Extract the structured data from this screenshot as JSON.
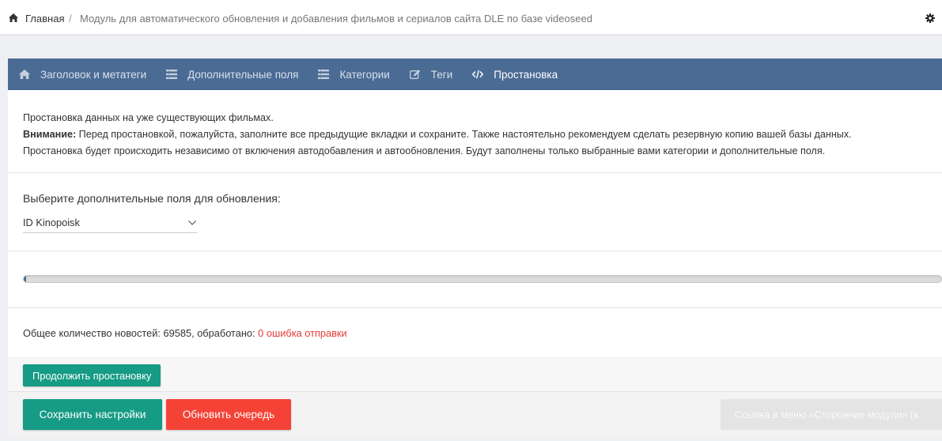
{
  "breadcrumb": {
    "home_label": "Главная",
    "separator": "/",
    "current": "Модуль для автоматического обновления и добавления фильмов и сериалов сайта DLE по базе videoseed"
  },
  "tabs": [
    {
      "label": "Заголовок и метатеги",
      "icon": "home-icon"
    },
    {
      "label": "Дополнительные поля",
      "icon": "list-icon"
    },
    {
      "label": "Категории",
      "icon": "list-icon"
    },
    {
      "label": "Теги",
      "icon": "edit-icon"
    },
    {
      "label": "Простановка",
      "icon": "code-icon",
      "active": true
    }
  ],
  "info": {
    "line1": "Простановка данных на уже существующих фильмах.",
    "warning_label": "Внимание:",
    "line2": " Перед простановкой, пожалуйста, заполните все предыдущие вкладки и сохраните. Также настоятельно рекомендуем сделать резервную копию вашей базы данных.",
    "line3": "Простановка будет происходить независимо от включения автодобавления и автообновления. Будут заполнены только выбранные вами категории и дополнительные поля."
  },
  "fields": {
    "label": "Выберите дополнительные поля для обновления:",
    "selected": "ID Kinopoisk"
  },
  "progress": {
    "fraction": 0.002
  },
  "stats": {
    "prefix": "Общее количество новостей: ",
    "total": "69585",
    "middle": ", обработано: ",
    "processed": "0",
    "error_text": " ошибка отправки"
  },
  "buttons": {
    "continue": "Продолжить простановку",
    "save": "Сохранить настройки",
    "refresh_queue": "Обновить очередь",
    "menu_link": "Ссылка в меню «Сторонние модули» (в"
  },
  "colors": {
    "tabbar": "#4a6b94",
    "green": "#169b85",
    "red": "#f44336",
    "error_text": "#e53935"
  }
}
